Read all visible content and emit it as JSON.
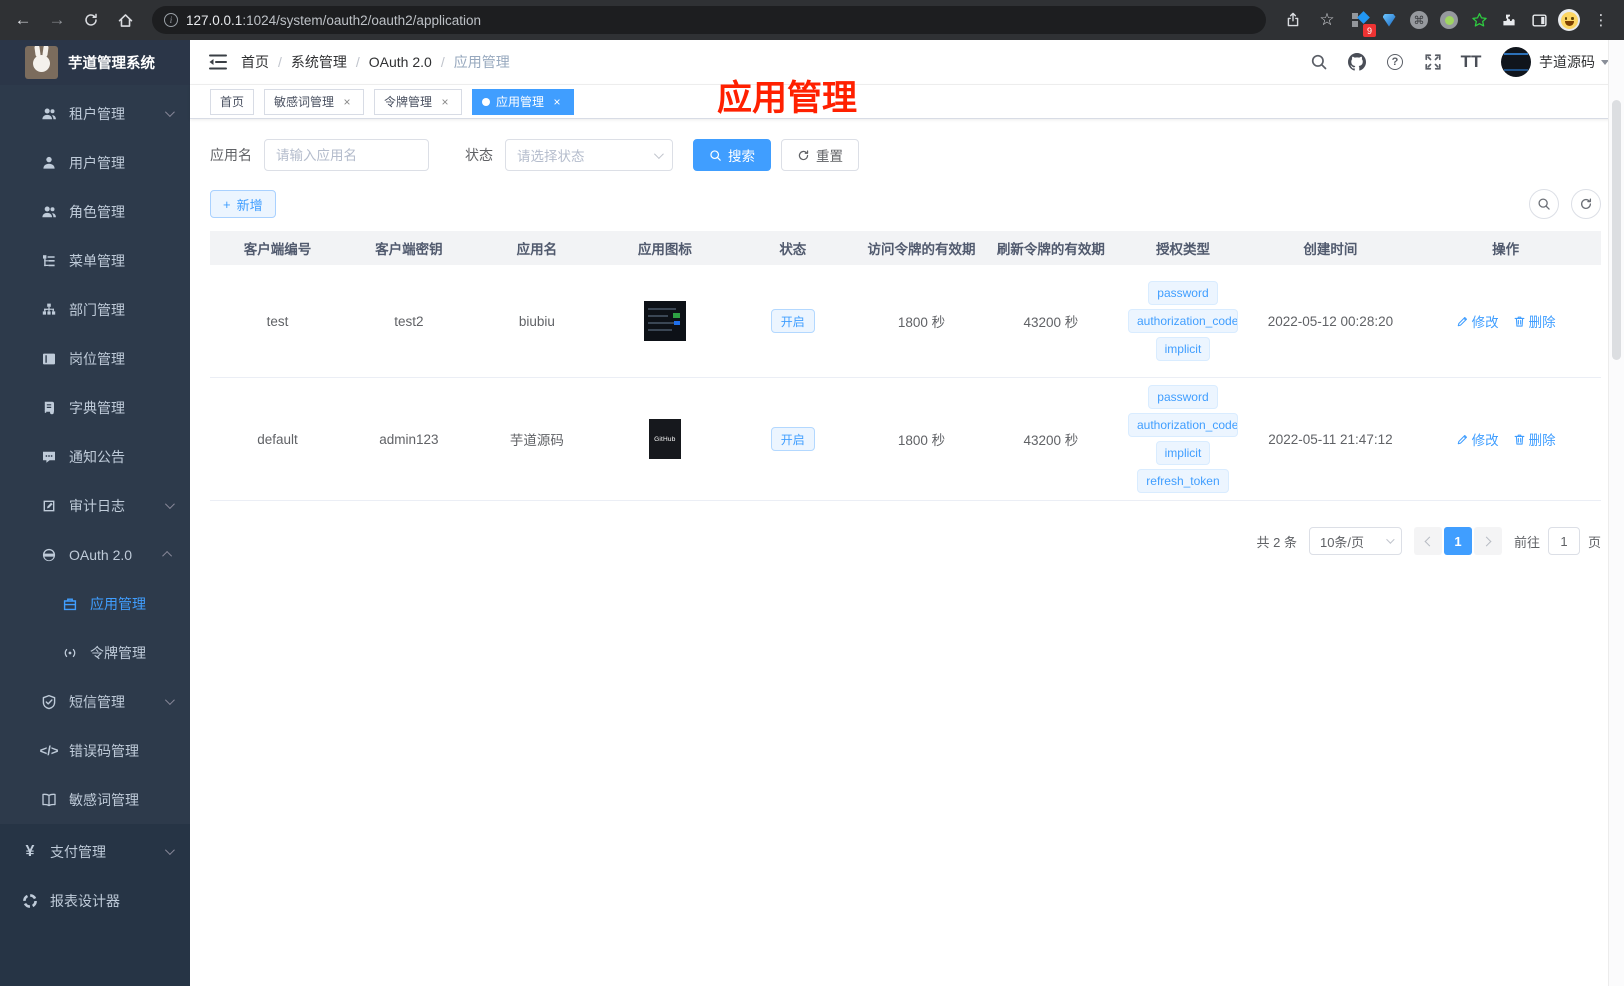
{
  "browser": {
    "url_domain": "127.0.0.1",
    "url_path": ":1024/system/oauth2/oauth2/application",
    "extension_badge": "9"
  },
  "icons": {
    "back": "←",
    "forward": "→",
    "star": "☆",
    "menu_dots": "⋮",
    "info": "i",
    "command": "⌘",
    "help": "?",
    "font_size": "TT",
    "plus": "+",
    "yen": "¥",
    "code": "</>",
    "breadcrumb_sep": "/"
  },
  "sidebar": {
    "title": "芋道管理系统",
    "menu": [
      {
        "label": "租户管理",
        "icon": "users-icon",
        "level": 2,
        "chevron": "down"
      },
      {
        "label": "用户管理",
        "icon": "user-icon",
        "level": 2
      },
      {
        "label": "角色管理",
        "icon": "users-icon",
        "level": 2
      },
      {
        "label": "菜单管理",
        "icon": "menu-tree-icon",
        "level": 2
      },
      {
        "label": "部门管理",
        "icon": "org-tree-icon",
        "level": 2
      },
      {
        "label": "岗位管理",
        "icon": "id-card-icon",
        "level": 2
      },
      {
        "label": "字典管理",
        "icon": "dictionary-icon",
        "level": 2
      },
      {
        "label": "通知公告",
        "icon": "comment-icon",
        "level": 2
      },
      {
        "label": "审计日志",
        "icon": "log-pen-icon",
        "level": 2,
        "chevron": "down"
      },
      {
        "label": "OAuth 2.0",
        "icon": "robot-icon",
        "level": 2,
        "chevron": "up"
      },
      {
        "label": "应用管理",
        "icon": "briefcase-icon",
        "level": 3,
        "active": true
      },
      {
        "label": "令牌管理",
        "icon": "signal-icon",
        "level": 3
      },
      {
        "label": "短信管理",
        "icon": "shield-icon",
        "level": 2,
        "chevron": "down"
      },
      {
        "label": "错误码管理",
        "icon": "code-icon",
        "level": 2
      },
      {
        "label": "敏感词管理",
        "icon": "open-book-icon",
        "level": 2
      },
      {
        "label": "支付管理",
        "icon": "yen-icon",
        "level": 1,
        "chevron": "down"
      },
      {
        "label": "报表设计器",
        "icon": "report-icon",
        "level": 1
      }
    ]
  },
  "navbar": {
    "breadcrumb": [
      "首页",
      "系统管理",
      "OAuth 2.0",
      "应用管理"
    ],
    "username": "芋道源码"
  },
  "tags": [
    {
      "label": "首页"
    },
    {
      "label": "敏感词管理",
      "closable": true
    },
    {
      "label": "令牌管理",
      "closable": true
    },
    {
      "label": "应用管理",
      "closable": true,
      "active": true
    }
  ],
  "overlay_title": "应用管理",
  "filters": {
    "name_label": "应用名",
    "name_placeholder": "请输入应用名",
    "status_label": "状态",
    "status_placeholder": "请选择状态",
    "search_label": "搜索",
    "reset_label": "重置"
  },
  "toolbar": {
    "add_label": "新增"
  },
  "table": {
    "headers": [
      "客户端编号",
      "客户端密钥",
      "应用名",
      "应用图标",
      "状态",
      "访问令牌的有效期",
      "刷新令牌的有效期",
      "授权类型",
      "创建时间",
      "操作"
    ],
    "rows": [
      {
        "client_id": "test",
        "secret": "test2",
        "name": "biubiu",
        "status": "开启",
        "access_ttl": "1800 秒",
        "refresh_ttl": "43200 秒",
        "grants": [
          "password",
          "authorization_code",
          "implicit"
        ],
        "created": "2022-05-12 00:28:20",
        "edit": "修改",
        "delete": "删除"
      },
      {
        "client_id": "default",
        "secret": "admin123",
        "name": "芋道源码",
        "icon_label": "GitHub",
        "status": "开启",
        "access_ttl": "1800 秒",
        "refresh_ttl": "43200 秒",
        "grants": [
          "password",
          "authorization_code",
          "implicit",
          "refresh_token"
        ],
        "created": "2022-05-11 21:47:12",
        "edit": "修改",
        "delete": "删除"
      }
    ]
  },
  "pagination": {
    "total": "共 2 条",
    "page_size": "10条/页",
    "current": "1",
    "goto_label": "前往",
    "goto_value": "1",
    "page_unit": "页"
  },
  "colors": {
    "accent": "#409eff",
    "tag_bg": "#ecf5ff",
    "sidebar_bg": "#2d3a4b",
    "sidebar_sub_bg": "#263445",
    "overlay_red": "#ff2000",
    "active_text": "#409eff"
  }
}
